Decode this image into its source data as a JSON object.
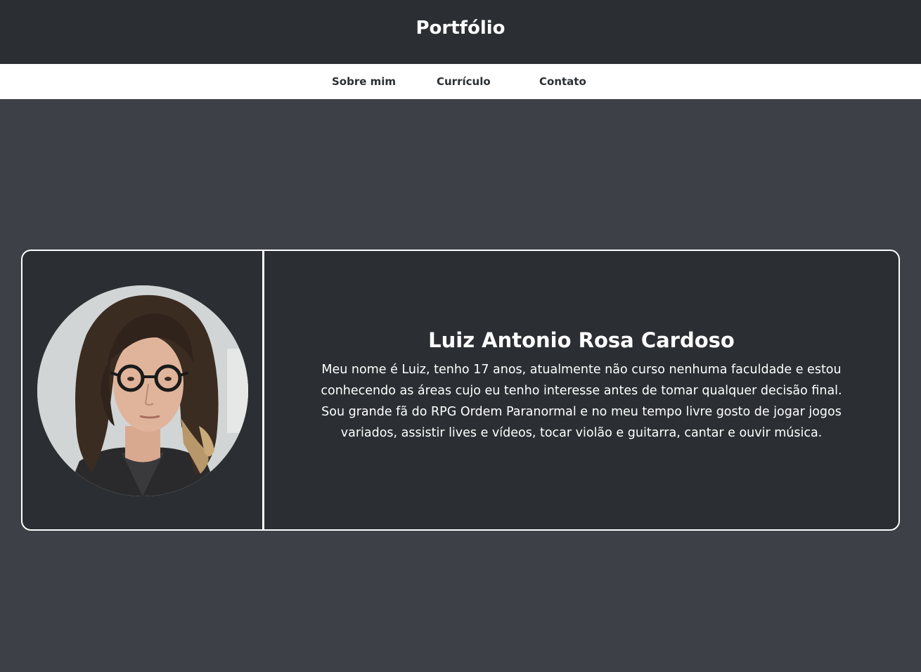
{
  "header": {
    "title": "Portfólio"
  },
  "nav": {
    "items": [
      {
        "label": "Sobre mim"
      },
      {
        "label": "Currículo"
      },
      {
        "label": "Contato"
      }
    ]
  },
  "profile": {
    "name": "Luiz Antonio Rosa Cardoso",
    "bio": "Meu nome é Luiz, tenho 17 anos, atualmente não curso nenhuma faculdade e estou conhecendo as áreas cujo eu tenho interesse antes de tomar qualquer decisão final. Sou grande fã do RPG Ordem Paranormal e no meu tempo livre gosto de jogar jogos variados, assistir lives e vídeos, tocar violão e guitarra, cantar e ouvir música."
  },
  "colors": {
    "page_background": "#3d4046",
    "header_background": "#2b2f33",
    "nav_background": "#ffffff",
    "card_background": "#2b2f33",
    "card_border": "#ffffff",
    "text_light": "#ffffff",
    "text_dark": "#2b2f33"
  },
  "icons": {
    "avatar": "profile-photo"
  }
}
